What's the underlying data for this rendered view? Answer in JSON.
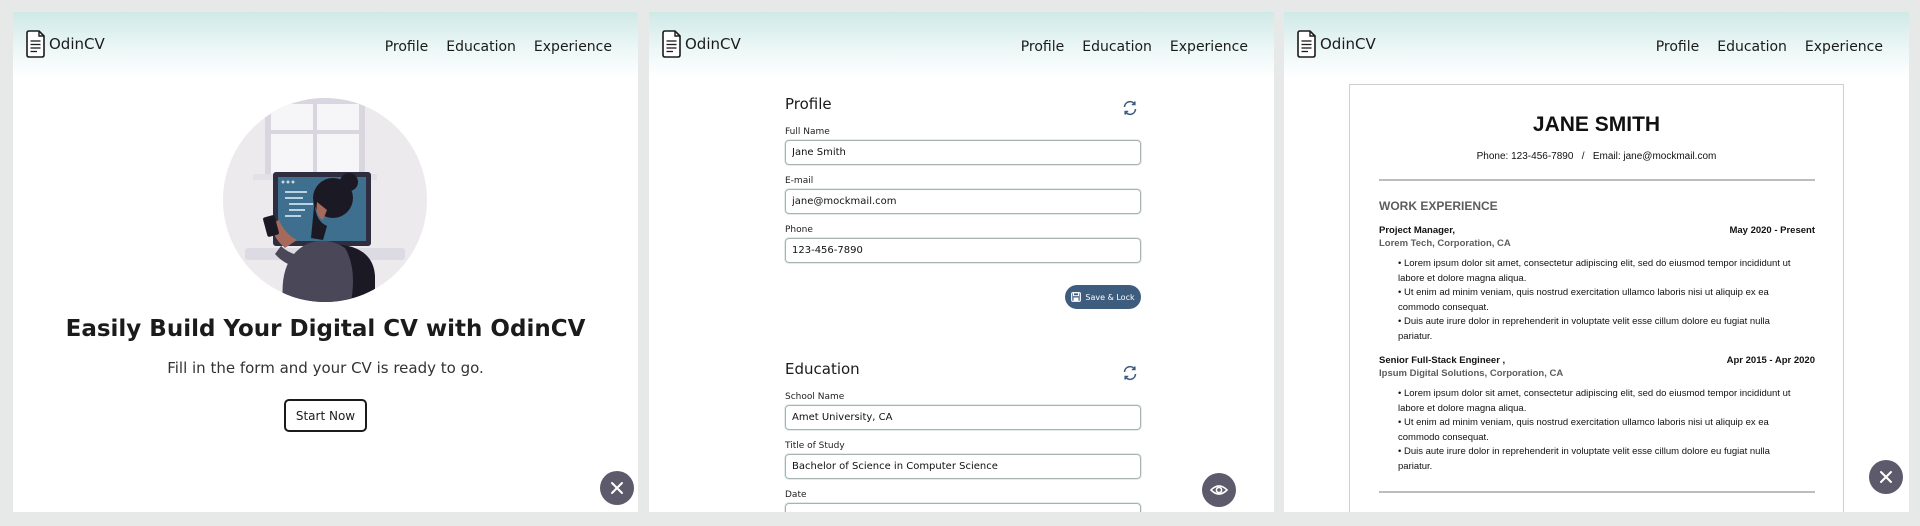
{
  "app": {
    "logo_text": "OdinCV",
    "nav": [
      "Profile",
      "Education",
      "Experience"
    ]
  },
  "landing": {
    "title": "Easily Build Your Digital CV with OdinCV",
    "subtitle": "Fill in the form and your CV is ready to go.",
    "start_label": "Start Now",
    "close_icon": "close-icon"
  },
  "profile_form": {
    "title": "Profile",
    "fields": [
      {
        "label": "Full Name",
        "value": "Jane Smith"
      },
      {
        "label": "E-mail",
        "value": "jane@mockmail.com"
      },
      {
        "label": "Phone",
        "value": "123-456-7890"
      }
    ],
    "save_label": "Save & Lock"
  },
  "education_form": {
    "title": "Education",
    "fields": [
      {
        "label": "School Name",
        "value": "Amet University, CA"
      },
      {
        "label": "Title of Study",
        "value": "Bachelor of Science in Computer Science"
      },
      {
        "label": "Date",
        "value": ""
      }
    ]
  },
  "resume": {
    "name": "JANE SMITH",
    "contact": "Phone: 123-456-7890   /   Email: jane@mockmail.com",
    "section_title": "WORK EXPERIENCE",
    "jobs": [
      {
        "title": "Project Manager,",
        "date": "May 2020 - Present",
        "company": "Lorem Tech, Corporation, CA",
        "bullets": [
          "• Lorem ipsum dolor sit amet, consectetur adipiscing elit, sed do eiusmod tempor incididunt ut labore et dolore magna aliqua.",
          "• Ut enim ad minim veniam, quis nostrud exercitation ullamco laboris nisi ut aliquip ex ea commodo consequat.",
          "• Duis aute irure dolor in reprehenderit in voluptate velit esse cillum dolore eu fugiat nulla pariatur."
        ]
      },
      {
        "title": "Senior Full-Stack Engineer ,",
        "date": "Apr 2015 - Apr 2020",
        "company": "Ipsum Digital Solutions, Corporation, CA",
        "bullets": [
          "• Lorem ipsum dolor sit amet, consectetur adipiscing elit, sed do eiusmod tempor incididunt ut labore et dolore magna aliqua.",
          "• Ut enim ad minim veniam, quis nostrud exercitation ullamco laboris nisi ut aliquip ex ea commodo consequat.",
          "• Duis aute irure dolor in reprehenderit in voluptate velit esse cillum dolore eu fugiat nulla pariatur."
        ]
      }
    ]
  },
  "colors": {
    "header_gradient_top": "#cfe9e7",
    "save_button": "#3e5c7e",
    "fab": "#5c5a6b"
  }
}
